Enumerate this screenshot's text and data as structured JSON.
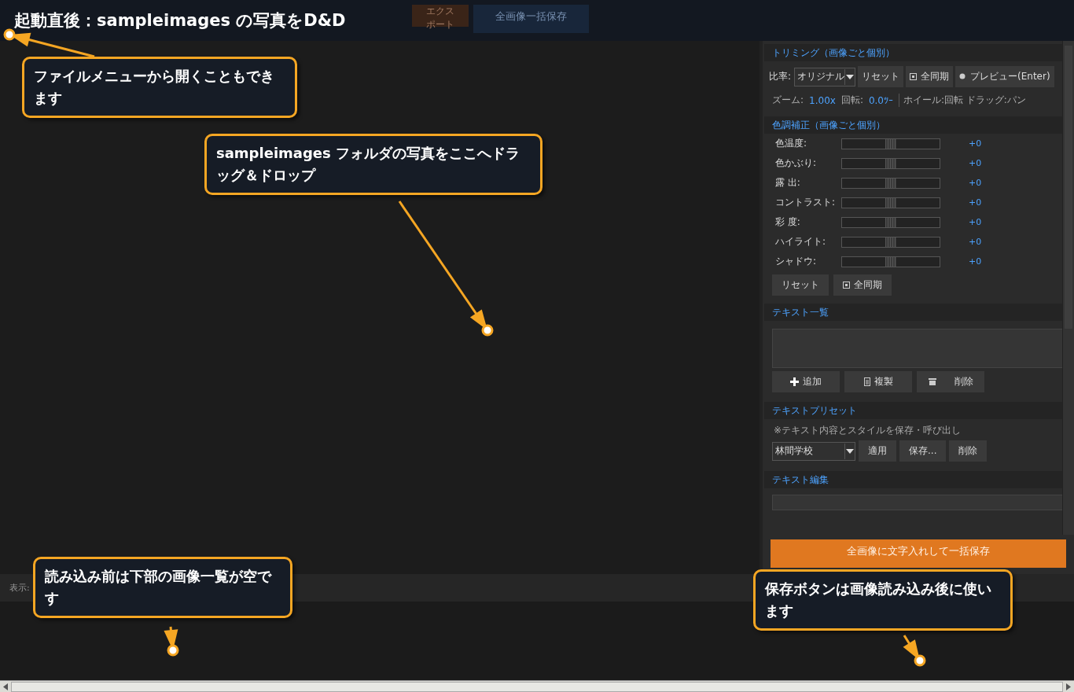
{
  "title": "起動直後：sampleimages の写真をD&D",
  "toolbar": [
    {
      "label": "エクスポート",
      "kind": "export"
    },
    {
      "label": "全画像一括保存",
      "kind": "save"
    }
  ],
  "trimming": {
    "heading": "トリミング（画像ごと個別）",
    "ratio_label": "比率:",
    "ratio_value": "オリジナル",
    "buttons": [
      {
        "label": "リセット",
        "kind": "plain"
      },
      {
        "label": "全同期",
        "kind": "sync"
      },
      {
        "label": "プレビュー(Enter)",
        "kind": "preview"
      }
    ],
    "zoom_label": "ズーム:",
    "zoom_value": "1.00x",
    "rotation_label": "回転:",
    "rotation_value": "0.0ﾂｰ",
    "hint": "ホイール:回転 ドラッグ:パン"
  },
  "color": {
    "heading": "色調補正（画像ごと個別）",
    "sliders": [
      {
        "name": "色温度:",
        "level": 0.5,
        "reading": "+0"
      },
      {
        "name": "色かぶり:",
        "level": 0.5,
        "reading": "+0"
      },
      {
        "name": "露 出:",
        "level": 0.5,
        "reading": "+0"
      },
      {
        "name": "コントラスト:",
        "level": 0.5,
        "reading": "+0"
      },
      {
        "name": "彩 度:",
        "level": 0.5,
        "reading": "+0"
      },
      {
        "name": "ハイライト:",
        "level": 0.5,
        "reading": "+0"
      },
      {
        "name": "シャドウ:",
        "level": 0.5,
        "reading": "+0"
      }
    ],
    "buttons": [
      {
        "label": "リセット",
        "kind": "plain"
      },
      {
        "label": "全同期",
        "kind": "sync"
      }
    ]
  },
  "text_list": {
    "heading": "テキスト一覧",
    "buttons": [
      {
        "label": "追加",
        "kind": "add"
      },
      {
        "label": "複製",
        "kind": "copy"
      },
      {
        "label": "削除",
        "kind": "delete"
      }
    ]
  },
  "preset": {
    "heading": "テキストプリセット",
    "note": "※テキスト内容とスタイルを保存・呼び出し",
    "value": "林間学校",
    "buttons": [
      {
        "label": "適用"
      },
      {
        "label": "保存..."
      },
      {
        "label": "削除"
      }
    ]
  },
  "text_edit": {
    "heading": "テキスト編集"
  },
  "save_button": {
    "label": "全画像に文字入れして一括保存"
  },
  "bottom_bar": {
    "view_label": "表示:"
  },
  "callouts": [
    {
      "text": "ファイルメニューから開くこともできます"
    },
    {
      "text": "sampleimages フォルダの写真をここへドラッグ＆ドロップ"
    },
    {
      "text": "読み込み前は下部の画像一覧が空です"
    },
    {
      "text": "保存ボタンは画像読み込み後に使います"
    }
  ]
}
